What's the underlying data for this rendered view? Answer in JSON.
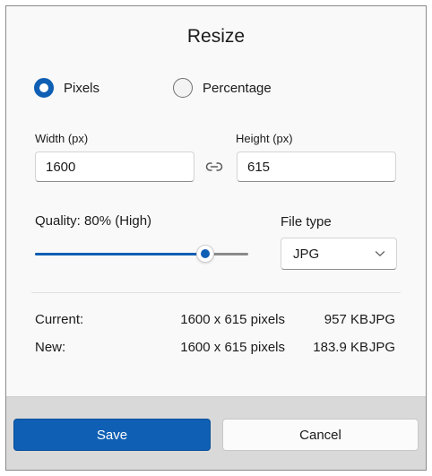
{
  "dialog": {
    "title": "Resize"
  },
  "mode": {
    "options": [
      {
        "label": "Pixels",
        "selected": true
      },
      {
        "label": "Percentage",
        "selected": false
      }
    ]
  },
  "width": {
    "label": "Width  (px)",
    "value": "1600"
  },
  "height": {
    "label": "Height  (px)",
    "value": "615"
  },
  "aspect_lock": {
    "icon": "link-icon"
  },
  "quality": {
    "label": "Quality: 80% (High)",
    "value_percent": 80
  },
  "file_type": {
    "label": "File type",
    "selected": "JPG"
  },
  "info": {
    "current": {
      "label": "Current:",
      "dimensions": "1600 x 615 pixels",
      "size": "957 KB",
      "type": "JPG"
    },
    "new": {
      "label": "New:",
      "dimensions": "1600 x 615 pixels",
      "size": "183.9 KB",
      "type": "JPG"
    }
  },
  "buttons": {
    "save": "Save",
    "cancel": "Cancel"
  },
  "colors": {
    "accent": "#0f5fb4",
    "footer_bg": "#d9d9d9",
    "dialog_bg": "#f9f9f9"
  }
}
